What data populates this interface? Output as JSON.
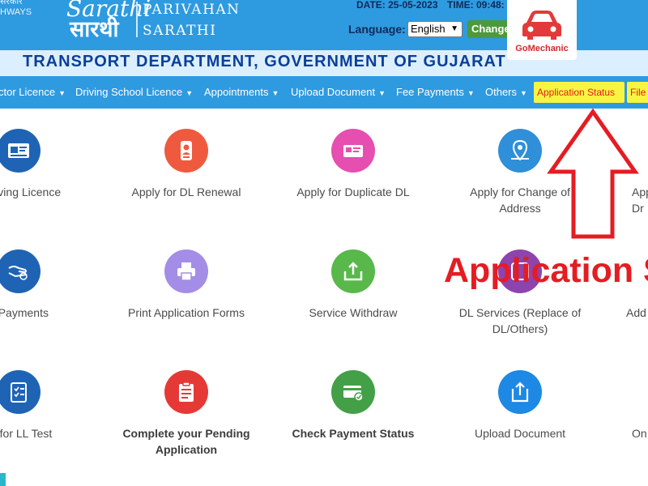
{
  "header": {
    "ministry_lines": [
      "सरकार",
      "HWAYS"
    ],
    "logo_en": "Sarathi",
    "logo_hi": "सारथी",
    "portal_line1": "PARIVAHAN",
    "portal_line2": "SARATHI",
    "date": "DATE: 25-05-2023",
    "time": "TIME: 09:48:",
    "language_label": "Language:",
    "language_value": "English",
    "change_button": "Change"
  },
  "watermark": {
    "brand": "GoMechanic",
    "color": "#e23a3a"
  },
  "department_title": "TRANSPORT DEPARTMENT, GOVERNMENT OF GUJARAT",
  "nav": {
    "items": [
      {
        "label": "ctor Licence"
      },
      {
        "label": "Driving School Licence"
      },
      {
        "label": "Appointments"
      },
      {
        "label": "Upload Document"
      },
      {
        "label": "Fee Payments"
      },
      {
        "label": "Others"
      }
    ],
    "application_status": "Application Status",
    "file": "File"
  },
  "tiles": [
    {
      "label": "r Driving Licence",
      "icon": "id-card-icon",
      "color": "#1f64b4"
    },
    {
      "label": "Apply for DL Renewal",
      "icon": "person-card-icon",
      "color": "#ef5a3e"
    },
    {
      "label": "Apply for Duplicate DL",
      "icon": "duplicate-card-icon",
      "color": "#e64fb0"
    },
    {
      "label": "Apply for Change of\nAddress",
      "icon": "location-pin-icon",
      "color": "#2f8fd8"
    },
    {
      "label": "App\nDr",
      "icon": "",
      "color": ""
    },
    {
      "label": "e Payments",
      "icon": "hand-coin-icon",
      "color": "#1f64b4"
    },
    {
      "label": "Print Application Forms",
      "icon": "printer-icon",
      "color": "#a48de6"
    },
    {
      "label": "Service Withdraw",
      "icon": "upload-box-icon",
      "color": "#58b84a"
    },
    {
      "label": "DL Services (Replace of\nDL/Others)",
      "icon": "services-icon",
      "color": "#8e44ad"
    },
    {
      "label": "Add",
      "icon": "",
      "color": ""
    },
    {
      "label": "ial for LL Test",
      "icon": "checklist-icon",
      "color": "#1f64b4"
    },
    {
      "label": "Complete your Pending\nApplication",
      "icon": "clipboard-icon",
      "color": "#e53935"
    },
    {
      "label": "Check Payment Status",
      "icon": "card-check-icon",
      "color": "#43a047"
    },
    {
      "label": "Upload Document",
      "icon": "upload-doc-icon",
      "color": "#1e88e5"
    },
    {
      "label": "On",
      "icon": "",
      "color": ""
    }
  ],
  "annotation": {
    "text": "Application S",
    "color": "#e51c23"
  },
  "theme": {
    "header_blue": "#2e9ae0",
    "dept_band": "#dcefff",
    "dept_text": "#0b3f9a",
    "status_yellow": "#f7f542"
  }
}
